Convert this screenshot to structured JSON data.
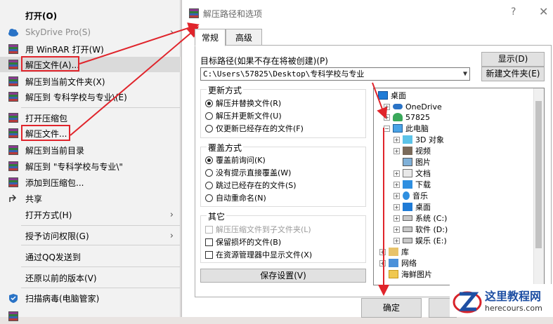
{
  "context_menu": {
    "items": [
      {
        "label": "打开(O)",
        "bold": true,
        "icon": "none"
      },
      {
        "label": "SkyDrive Pro(S)",
        "disabled": true,
        "submenu": true,
        "icon": "cloud-icon"
      },
      {
        "label": "用 WinRAR 打开(W)",
        "icon": "winrar-icon"
      },
      {
        "label": "解压文件(A)...",
        "highlighted": true,
        "icon": "winrar-icon"
      },
      {
        "label": "解压到当前文件夹(X)",
        "icon": "winrar-icon"
      },
      {
        "label": "解压到 专科学校与专业\\(E)",
        "icon": "winrar-icon"
      },
      {
        "label": "打开压缩包",
        "icon": "winrar-archive-icon"
      },
      {
        "label": "解压文件...",
        "icon": "winrar-archive-icon"
      },
      {
        "label": "解压到当前目录",
        "icon": "winrar-archive-icon"
      },
      {
        "label": "解压到 \"专科学校与专业\\\"",
        "icon": "winrar-archive-icon"
      },
      {
        "label": "添加到压缩包...",
        "icon": "winrar-archive-icon"
      },
      {
        "label": "共享",
        "icon": "share-icon"
      },
      {
        "label": "打开方式(H)",
        "submenu": true,
        "icon": "none"
      },
      {
        "label": "授予访问权限(G)",
        "submenu": true,
        "icon": "none"
      },
      {
        "label": "通过QQ发送到",
        "icon": "none"
      },
      {
        "label": "还原以前的版本(V)",
        "icon": "none"
      },
      {
        "label": "扫描病毒(电脑管家)",
        "icon": "shield-icon"
      }
    ]
  },
  "dialog": {
    "title": "解压路径和选项",
    "help": "?",
    "close": "✕",
    "tabs": [
      "常规",
      "高级"
    ],
    "target_path_label": "目标路径(如果不存在将被创建)(P)",
    "target_path_value": "C:\\Users\\57825\\Desktop\\专科学校与专业",
    "show_button": "显示(D)",
    "new_folder_button": "新建文件夹(E)",
    "update_mode": {
      "title": "更新方式",
      "options": [
        "解压并替换文件(R)",
        "解压并更新文件(U)",
        "仅更新已经存在的文件(F)"
      ],
      "selected": 0
    },
    "overwrite_mode": {
      "title": "覆盖方式",
      "options": [
        "覆盖前询问(K)",
        "没有提示直接覆盖(W)",
        "跳过已经存在的文件(S)",
        "自动重命名(N)"
      ],
      "selected": 0
    },
    "misc": {
      "title": "其它",
      "options": [
        "解压压缩文件到子文件夹(L)",
        "保留损坏的文件(B)",
        "在资源管理器中显示文件(X)"
      ],
      "disabled_index": 0
    },
    "save_settings_button": "保存设置(V)",
    "tree": [
      {
        "label": "桌面",
        "icon": "desktop-icon"
      },
      {
        "label": "OneDrive",
        "icon": "onedrive-icon"
      },
      {
        "label": "57825",
        "icon": "user-icon"
      },
      {
        "label": "此电脑",
        "icon": "computer-icon"
      },
      {
        "label": "3D 对象",
        "icon": "3d-objects-icon"
      },
      {
        "label": "视频",
        "icon": "video-icon"
      },
      {
        "label": "图片",
        "icon": "pictures-icon"
      },
      {
        "label": "文档",
        "icon": "documents-icon"
      },
      {
        "label": "下载",
        "icon": "download-icon"
      },
      {
        "label": "音乐",
        "icon": "music-icon"
      },
      {
        "label": "桌面",
        "icon": "desktop-icon"
      },
      {
        "label": "系统 (C:)",
        "icon": "drive-icon"
      },
      {
        "label": "软件 (D:)",
        "icon": "drive-icon"
      },
      {
        "label": "娱乐 (E:)",
        "icon": "drive-icon"
      },
      {
        "label": "库",
        "icon": "library-icon"
      },
      {
        "label": "网络",
        "icon": "network-icon"
      },
      {
        "label": "海鲜图片",
        "icon": "folder-icon"
      }
    ],
    "ok_button": "确定"
  },
  "watermark": {
    "title": "这里教程网",
    "url": "herecours.com"
  },
  "colors": {
    "annotation_red": "#e0242b",
    "watermark_blue": "#1e4fa3"
  }
}
